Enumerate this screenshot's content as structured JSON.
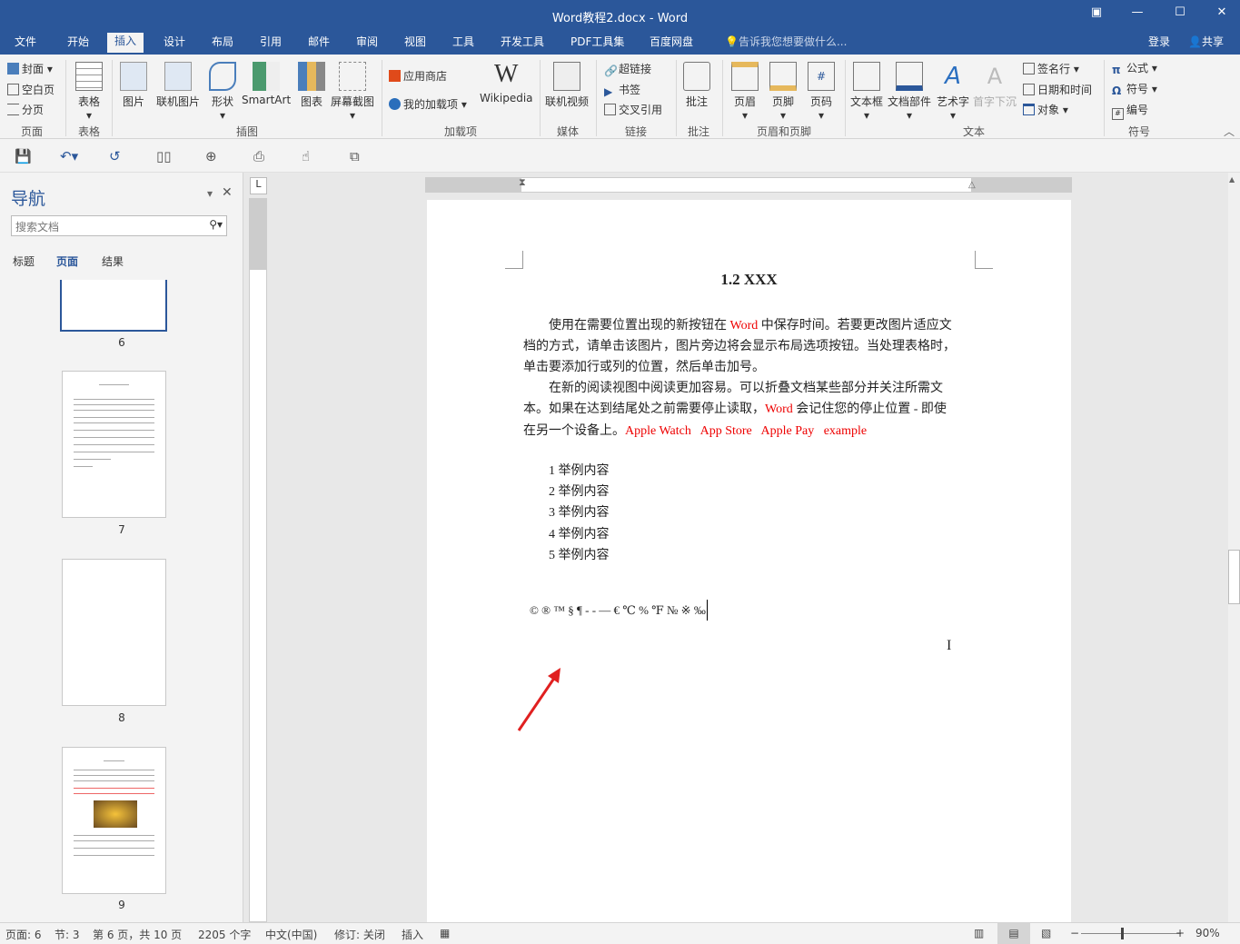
{
  "window": {
    "title": "Word教程2.docx - Word"
  },
  "menu": {
    "tabs": [
      "文件",
      "开始",
      "插入",
      "设计",
      "布局",
      "引用",
      "邮件",
      "审阅",
      "视图",
      "工具",
      "开发工具",
      "PDF工具集",
      "百度网盘"
    ],
    "active": "插入",
    "tell_me": "告诉我您想要做什么...",
    "login": "登录",
    "share": "共享"
  },
  "ribbon": {
    "page": {
      "items": [
        "封面",
        "空白页",
        "分页"
      ],
      "label": "页面"
    },
    "table": {
      "button": "表格",
      "label": "表格"
    },
    "illustrations": {
      "buttons": [
        "图片",
        "联机图片",
        "形状",
        "SmartArt",
        "图表",
        "屏幕截图"
      ],
      "label": "插图"
    },
    "addins": {
      "store": "应用商店",
      "my_addins": "我的加载项",
      "wikipedia": "Wikipedia",
      "label": "加载项"
    },
    "media": {
      "button": "联机视频",
      "label": "媒体"
    },
    "links": {
      "items": [
        "超链接",
        "书签",
        "交叉引用"
      ],
      "label": "链接"
    },
    "comments": {
      "button": "批注",
      "label": "批注"
    },
    "header_footer": {
      "buttons": [
        "页眉",
        "页脚",
        "页码"
      ],
      "label": "页眉和页脚"
    },
    "text": {
      "buttons": [
        "文本框",
        "文档部件",
        "艺术字",
        "首字下沉"
      ],
      "small": [
        "签名行",
        "日期和时间",
        "对象"
      ],
      "label": "文本"
    },
    "symbols": {
      "items": [
        "公式",
        "符号",
        "编号"
      ],
      "label": "符号"
    }
  },
  "nav": {
    "title": "导航",
    "search_placeholder": "搜索文档",
    "tabs": [
      "标题",
      "页面",
      "结果"
    ],
    "active_tab": "页面",
    "pages": [
      "6",
      "7",
      "8",
      "9"
    ]
  },
  "document": {
    "heading": "1.2 XXX",
    "para1": [
      {
        "t": "使用在需要位置出现的新按钮在 "
      },
      {
        "t": "Word",
        "red": true
      },
      {
        "t": " 中保存时间。若要更改图片适应文"
      }
    ],
    "para1_l2": "档的方式，请单击该图片，图片旁边将会显示布局选项按钮。当处理表格时，",
    "para1_l3": "单击要添加行或列的位置，然后单击加号。",
    "para2_l1": "在新的阅读视图中阅读更加容易。可以折叠文档某些部分并关注所需文",
    "para2_l2": [
      {
        "t": "本。如果在达到结尾处之前需要停止读取，"
      },
      {
        "t": "Word",
        "red": true
      },
      {
        "t": " 会记住您的停止位置 - 即使"
      }
    ],
    "para2_l3": [
      {
        "t": "在另一个设备上。"
      },
      {
        "t": "Apple Watch   App Store   Apple Pay   example",
        "red": true
      }
    ],
    "list": [
      "1 举例内容",
      "2 举例内容",
      "3 举例内容",
      "4 举例内容",
      "5 举例内容"
    ],
    "symbols_line": "© ® ™ § ¶ - - — € ℃ % ℉ № ※ ‰"
  },
  "status": {
    "page": "页面: 6",
    "section": "节: 3",
    "page_of": "第 6 页，共 10 页",
    "words": "2205 个字",
    "language": "中文(中国)",
    "track": "修订: 关闭",
    "mode": "插入",
    "zoom": "90%"
  },
  "colors": {
    "brand": "#2b579a",
    "accent_red": "#e00000"
  }
}
